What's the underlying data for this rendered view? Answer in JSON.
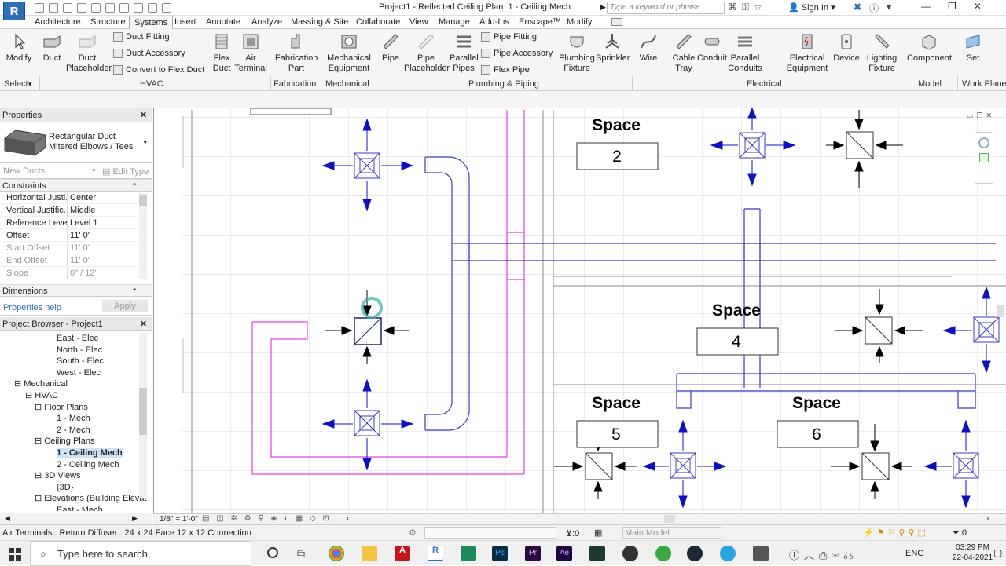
{
  "window": {
    "title": "Project1 - Reflected Ceiling Plan: 1 - Ceiling Mech",
    "logo": "R",
    "search_placeholder": "Type a keyword or phrase",
    "sign_in": "Sign In"
  },
  "tabs": [
    "Architecture",
    "Structure",
    "Systems",
    "Insert",
    "Annotate",
    "Analyze",
    "Massing & Site",
    "Collaborate",
    "View",
    "Manage",
    "Add-Ins",
    "Enscape™",
    "Modify"
  ],
  "ribbon": {
    "tools": [
      {
        "label": "Modify",
        "icon": "cursor-icon"
      },
      {
        "label": "Duct",
        "icon": "duct-icon"
      },
      {
        "label": "Duct Placeholder",
        "icon": "duct-placeholder-icon"
      },
      {
        "label": "Flex Duct",
        "icon": "flex-duct-icon"
      },
      {
        "label": "Air Terminal",
        "icon": "air-terminal-icon"
      },
      {
        "label": "Fabrication Part",
        "icon": "fabrication-icon"
      },
      {
        "label": "Mechanical Equipment",
        "icon": "mech-equipment-icon"
      },
      {
        "label": "Pipe",
        "icon": "pipe-icon"
      },
      {
        "label": "Pipe Placeholder",
        "icon": "pipe-placeholder-icon"
      },
      {
        "label": "Parallel Pipes",
        "icon": "parallel-pipes-icon"
      },
      {
        "label": "Plumbing Fixture",
        "icon": "plumbing-fixture-icon"
      },
      {
        "label": "Sprinkler",
        "icon": "sprinkler-icon"
      },
      {
        "label": "Wire",
        "icon": "wire-icon"
      },
      {
        "label": "Cable Tray",
        "icon": "cable-tray-icon"
      },
      {
        "label": "Conduit",
        "icon": "conduit-icon"
      },
      {
        "label": "Parallel Conduits",
        "icon": "parallel-conduits-icon"
      },
      {
        "label": "Electrical Equipment",
        "icon": "electrical-equipment-icon"
      },
      {
        "label": "Device",
        "icon": "device-icon"
      },
      {
        "label": "Lighting Fixture",
        "icon": "lighting-fixture-icon"
      },
      {
        "label": "Component",
        "icon": "component-icon"
      },
      {
        "label": "Set",
        "icon": "set-icon"
      }
    ],
    "small_tools": [
      "Duct Fitting",
      "Duct Accessory",
      "Convert to Flex Duct",
      "Pipe Fitting",
      "Pipe Accessory",
      "Flex Pipe"
    ],
    "panels": [
      "Select",
      "HVAC",
      "Fabrication",
      "Mechanical",
      "Plumbing & Piping",
      "Electrical",
      "Model",
      "Work Plane"
    ]
  },
  "properties": {
    "header": "Properties",
    "type_name": "Rectangular Duct",
    "type_sub": "Mitered Elbows / Tees",
    "filter": "New Ducts",
    "edit_type": "Edit Type",
    "group_constraints": "Constraints",
    "rows": [
      {
        "k": "Horizontal Justi...",
        "v": "Center"
      },
      {
        "k": "Vertical Justific...",
        "v": "Middle"
      },
      {
        "k": "Reference Level",
        "v": "Level 1"
      },
      {
        "k": "Offset",
        "v": "11'  0\""
      },
      {
        "k": "Start Offset",
        "v": "11'  0\""
      },
      {
        "k": "End Offset",
        "v": "11'  0\""
      },
      {
        "k": "Slope",
        "v": "0\" / 12\""
      }
    ],
    "group_dimensions": "Dimensions",
    "help": "Properties help",
    "apply": "Apply"
  },
  "browser": {
    "header": "Project Browser - Project1",
    "items": [
      "East - Elec",
      "North - Elec",
      "South - Elec",
      "West - Elec",
      "Mechanical",
      "HVAC",
      "Floor Plans",
      "1 - Mech",
      "2 - Mech",
      "Ceiling Plans",
      "1 - Ceiling Mech",
      "2 - Ceiling Mech",
      "3D Views",
      "{3D}",
      "Elevations (Building Elevat",
      "East - Mech"
    ]
  },
  "canvas": {
    "space_label": "Space",
    "spaces": [
      "2",
      "4",
      "5",
      "6"
    ]
  },
  "view_bar": {
    "scale": "1/8\" = 1'-0\""
  },
  "status": {
    "text": "Air Terminals : Return Diffuser : 24 x 24 Face 12 x 12 Connection",
    "zero": ":0",
    "model": "Main Model",
    "filter_count": ":0"
  },
  "taskbar": {
    "search_placeholder": "Type here to search",
    "lang": "ENG",
    "time": "03:29 PM",
    "date": "22-04-2021"
  },
  "colors": {
    "duct": "#3b3bbf",
    "pipe": "#e040e0",
    "arrow": "#1010c0",
    "accent": "#2f6fb6"
  }
}
